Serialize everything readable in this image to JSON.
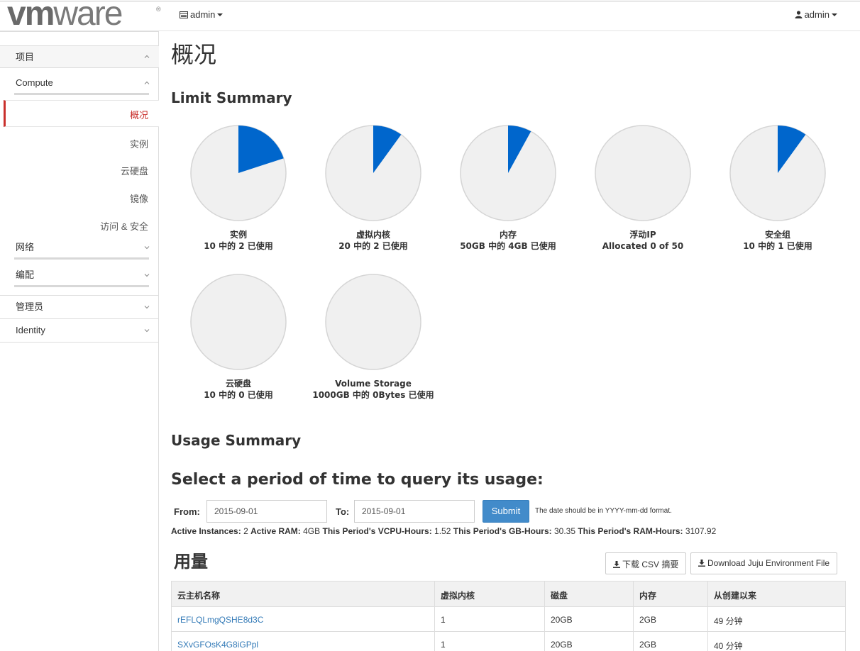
{
  "topbar": {
    "logo_bold": "vm",
    "logo_light": "ware",
    "logo_reg": "®",
    "project_menu": "admin",
    "user_menu": "admin",
    "project_icon": "folder-icon",
    "user_icon": "user-icon"
  },
  "sidebar": {
    "project": "项目",
    "compute": "Compute",
    "items": [
      "概况",
      "实例",
      "云硬盘",
      "镜像",
      "访问 & 安全"
    ],
    "active_item": "概况",
    "network": "网络",
    "orchestration": "编配",
    "admin": "管理员",
    "identity": "Identity",
    "accent_color": "#c9302c"
  },
  "main": {
    "title": "概况",
    "limit_summary": "Limit Summary",
    "usage_summary": "Usage Summary",
    "select_period": "Select a period of time to query its usage:"
  },
  "chart_data": {
    "type": "pie",
    "fill_color": "#0066cc",
    "empty_color": "#f0f0f0",
    "charts": [
      {
        "name": "实例",
        "caption": "10 中的 2 已使用",
        "used": 2,
        "total": 10
      },
      {
        "name": "虚拟内核",
        "caption": "20 中的 2 已使用",
        "used": 2,
        "total": 20
      },
      {
        "name": "内存",
        "caption": "50GB 中的 4GB 已使用",
        "used": 4,
        "total": 50
      },
      {
        "name": "浮动IP",
        "caption": "Allocated 0 of 50",
        "used": 0,
        "total": 50
      },
      {
        "name": "安全组",
        "caption": "10 中的 1 已使用",
        "used": 1,
        "total": 10
      },
      {
        "name": "云硬盘",
        "caption": "10 中的 0 已使用",
        "used": 0,
        "total": 10
      },
      {
        "name": "Volume Storage",
        "caption": "1000GB 中的 0Bytes 已使用",
        "used": 0,
        "total": 1000
      }
    ]
  },
  "form": {
    "from_label": "From:",
    "from_value": "2015-09-01",
    "to_label": "To:",
    "to_value": "2015-09-01",
    "submit_label": "Submit",
    "hint": "The date should be in YYYY-mm-dd format.",
    "submit_color": "#428bca"
  },
  "stats": {
    "active_instances_label": "Active Instances:",
    "active_instances": "2",
    "active_ram_label": "Active RAM:",
    "active_ram": "4GB",
    "vcpu_hours_label": "This Period's VCPU-Hours:",
    "vcpu_hours": "1.52",
    "gb_hours_label": "This Period's GB-Hours:",
    "gb_hours": "30.35",
    "ram_hours_label": "This Period's RAM-Hours:",
    "ram_hours": "3107.92"
  },
  "usage": {
    "title": "用量",
    "csv_button": "下载 CSV 摘要",
    "juju_button": "Download Juju Environment File",
    "download_icon": "download-icon",
    "columns": [
      "云主机名称",
      "虚拟内核",
      "磁盘",
      "内存",
      "从创建以来"
    ],
    "rows": [
      [
        "rEFLQLmgQSHE8d3C",
        "1",
        "20GB",
        "2GB",
        "49 分钟"
      ],
      [
        "SXvGFOsK4G8iGPpl",
        "1",
        "20GB",
        "2GB",
        "40 分钟"
      ]
    ]
  }
}
